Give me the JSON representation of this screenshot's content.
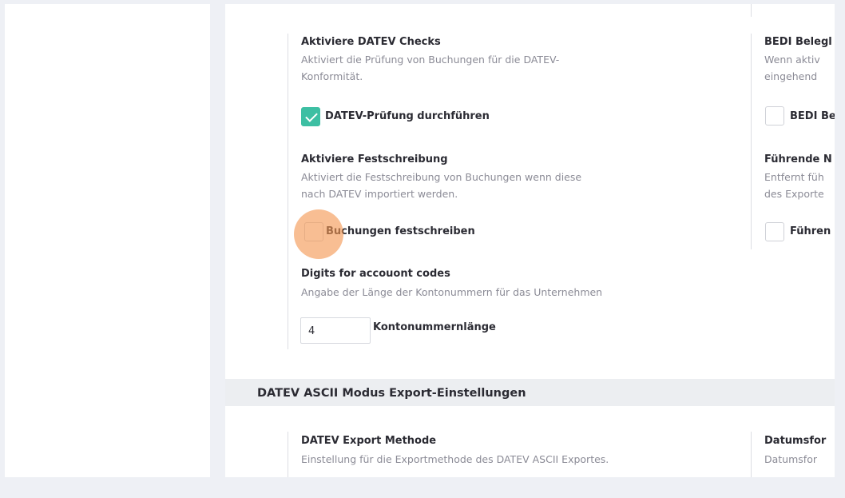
{
  "settings": {
    "datev_checks": {
      "title": "Aktiviere DATEV Checks",
      "desc_line1": "Aktiviert die Prüfung von Buchungen für die DATEV-",
      "desc_line2": "Konformität.",
      "checkbox_label": "DATEV-Prüfung durchführen",
      "checked": true
    },
    "festschreibung": {
      "title": "Aktiviere Festschreibung",
      "desc_line1": "Aktiviert die Festschreibung von Buchungen wenn diese",
      "desc_line2": "nach DATEV importiert werden.",
      "checkbox_label": "Buchungen festschreiben",
      "checked": false
    },
    "digits": {
      "title": "Digits for accouont codes",
      "desc": "Angabe der Länge der Kontonummern für das Unternehmen",
      "input_value": "4",
      "input_label": "Kontonummernlänge"
    }
  },
  "right_column": {
    "bedi_title": "BEDI Belegl",
    "bedi_desc_line1": "Wenn aktiv",
    "bedi_desc_line2": "eingehend",
    "bedi_checkbox_label": "BEDI Be",
    "fuehrende_title": "Führende N",
    "fuehrende_desc_line1": "Entfernt füh",
    "fuehrende_desc_line2": "des Exporte",
    "fuehrende_checkbox_label": "Führen",
    "datumsformat_title": "Datumsfor",
    "datumsformat_desc": "Datumsfor"
  },
  "ascii_section": {
    "header": "DATEV ASCII Modus Export-Einstellungen",
    "export_method": {
      "title": "DATEV Export Methode",
      "desc_line1": "Einstellung für die Exportmethode des DATEV ASCII Exportes."
    }
  },
  "colors": {
    "accent": "#3dbfa3",
    "cursor": "#f4964f"
  }
}
